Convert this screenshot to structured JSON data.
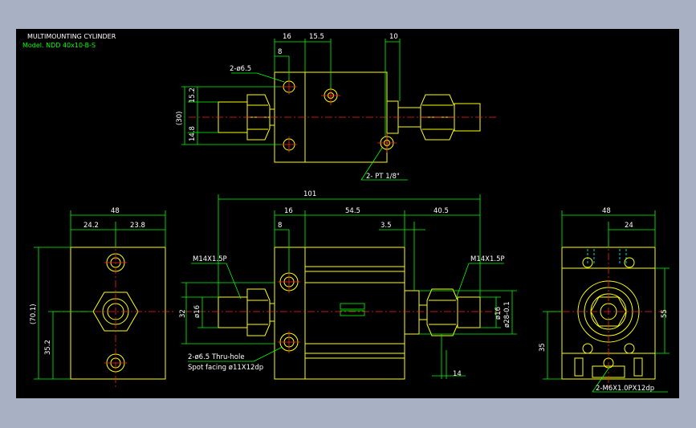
{
  "title": "MULTIMOUNTING CYLINDER",
  "model": "Model. NDD 40x10-B-S",
  "colors": {
    "background": "#000000",
    "outline": "#ffff00",
    "dimension": "#00ff00",
    "centerline": "#ff2020",
    "text": "#ffffff"
  },
  "top_view": {
    "dim_16": "16",
    "dim_15_5": "15.5",
    "dim_10": "10",
    "dim_8": "8",
    "dim_15_2": "15.2",
    "dim_14_8": "14.8",
    "dim_30": "(30)",
    "hole_note": "2-ø6.5",
    "port_note": "2- PT 1/8\""
  },
  "front_view": {
    "dim_101": "101",
    "dim_16": "16",
    "dim_54_5": "54.5",
    "dim_40_5": "40.5",
    "dim_8": "8",
    "dim_3_5": "3.5",
    "thread_left": "M14X1.5P",
    "thread_right": "M14X1.5P",
    "dim_32": "32",
    "dim_16_left": "ø16",
    "dim_16_right": "ø16",
    "dim_28": "ø28-0.1",
    "dim_14": "14",
    "hole_note": "2-ø6.5 Thru-hole",
    "spot_note": "Spot facing  ø11X12dp"
  },
  "left_view": {
    "dim_48": "48",
    "dim_24_2": "24.2",
    "dim_23_8": "23.8",
    "dim_70_1": "(70.1)",
    "dim_35_2": "35.2"
  },
  "right_view": {
    "dim_48": "48",
    "dim_24": "24",
    "dim_55": "55",
    "dim_35": "35",
    "tap_note": "2-M6X1.0PX12dp"
  }
}
